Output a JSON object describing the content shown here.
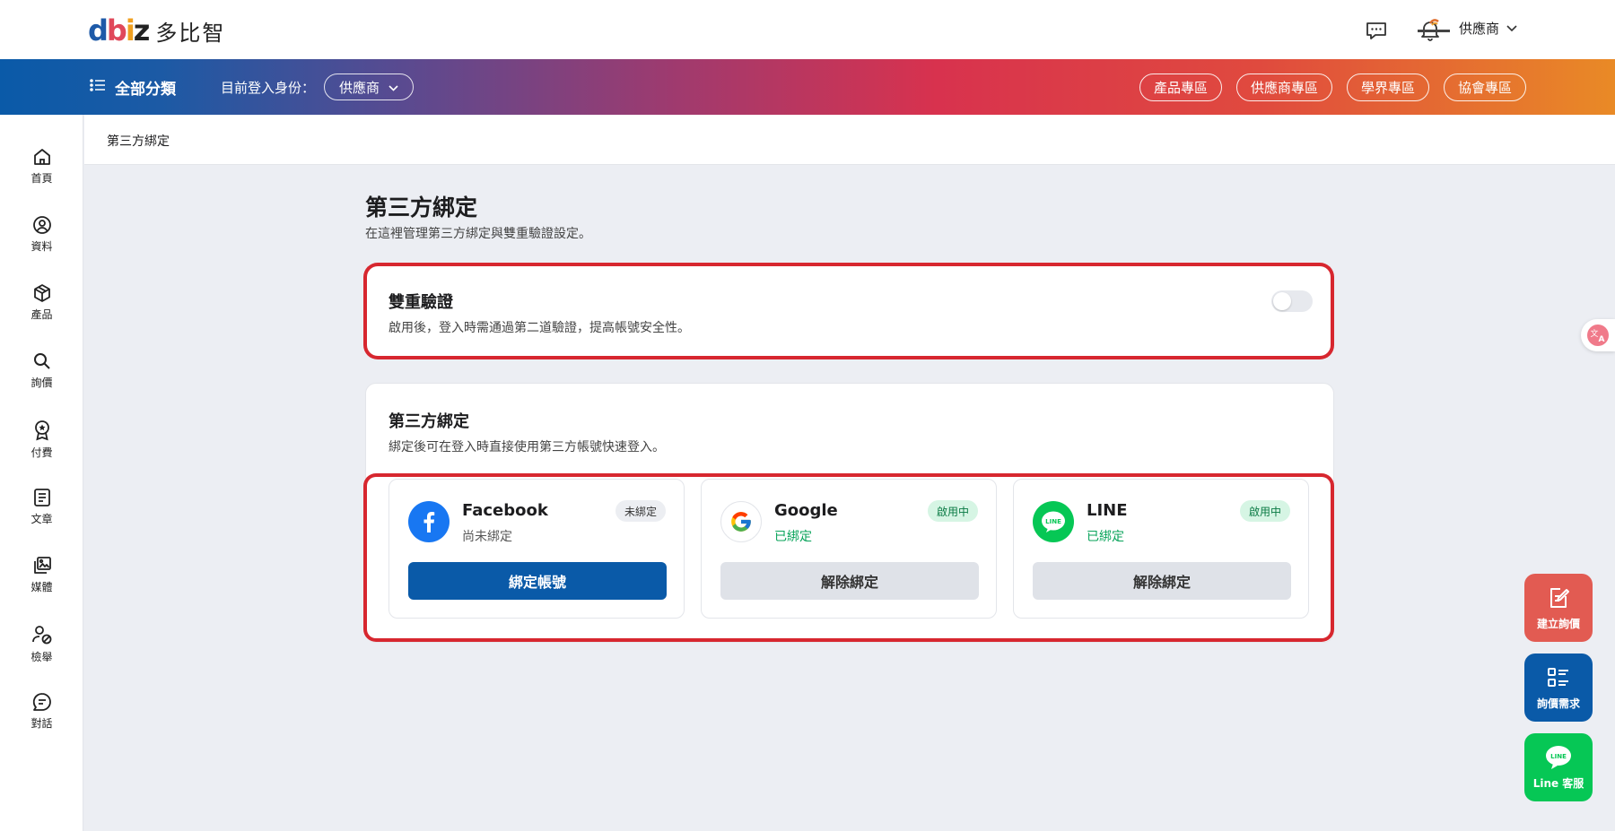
{
  "brand": {
    "mark": [
      "d",
      "b",
      "i",
      "z"
    ],
    "name": "多比智"
  },
  "header": {
    "user_label": "供應商",
    "icons": [
      "chat-icon",
      "bell-icon",
      "chevron-down-icon"
    ]
  },
  "nav": {
    "category_label": "全部分類",
    "identity_label": "目前登入身份：",
    "identity_value": "供應商",
    "zones": [
      "產品專區",
      "供應商專區",
      "學界專區",
      "協會專區"
    ]
  },
  "sidebar": {
    "items": [
      {
        "label": "首頁",
        "icon": "home-icon"
      },
      {
        "label": "資料",
        "icon": "user-icon"
      },
      {
        "label": "產品",
        "icon": "box-icon"
      },
      {
        "label": "詢價",
        "icon": "search-icon"
      },
      {
        "label": "付費",
        "icon": "badge-icon"
      },
      {
        "label": "文章",
        "icon": "document-icon"
      },
      {
        "label": "媒體",
        "icon": "gallery-icon"
      },
      {
        "label": "檢舉",
        "icon": "report-user-icon"
      },
      {
        "label": "對話",
        "icon": "message-icon"
      }
    ]
  },
  "breadcrumb": "第三方綁定",
  "page": {
    "title": "第三方綁定",
    "subtitle": "在這裡管理第三方綁定與雙重驗證設定。"
  },
  "two_factor": {
    "title": "雙重驗證",
    "description": "啟用後，登入時需通過第二道驗證，提高帳號安全性。",
    "enabled": false
  },
  "third_party": {
    "title": "第三方綁定",
    "description": "綁定後可在登入時直接使用第三方帳號快速登入。",
    "providers": [
      {
        "name": "Facebook",
        "state": "尚未綁定",
        "badge": "未綁定",
        "button": "綁定帳號",
        "bound": false,
        "brand_color": "#1877f2"
      },
      {
        "name": "Google",
        "state": "已綁定",
        "badge": "啟用中",
        "button": "解除綁定",
        "bound": true,
        "brand_color": "#4285f4"
      },
      {
        "name": "LINE",
        "state": "已綁定",
        "badge": "啟用中",
        "button": "解除綁定",
        "bound": true,
        "brand_color": "#06c755"
      }
    ]
  },
  "floating": {
    "create_inquiry": "建立詢價",
    "inquiry_demand": "詢價需求",
    "line_service": "Line 客服",
    "line_badge": "LINE"
  },
  "colors": {
    "accent_red": "#d7272f",
    "primary_blue": "#0a5aa8",
    "success_green": "#08a35a"
  }
}
